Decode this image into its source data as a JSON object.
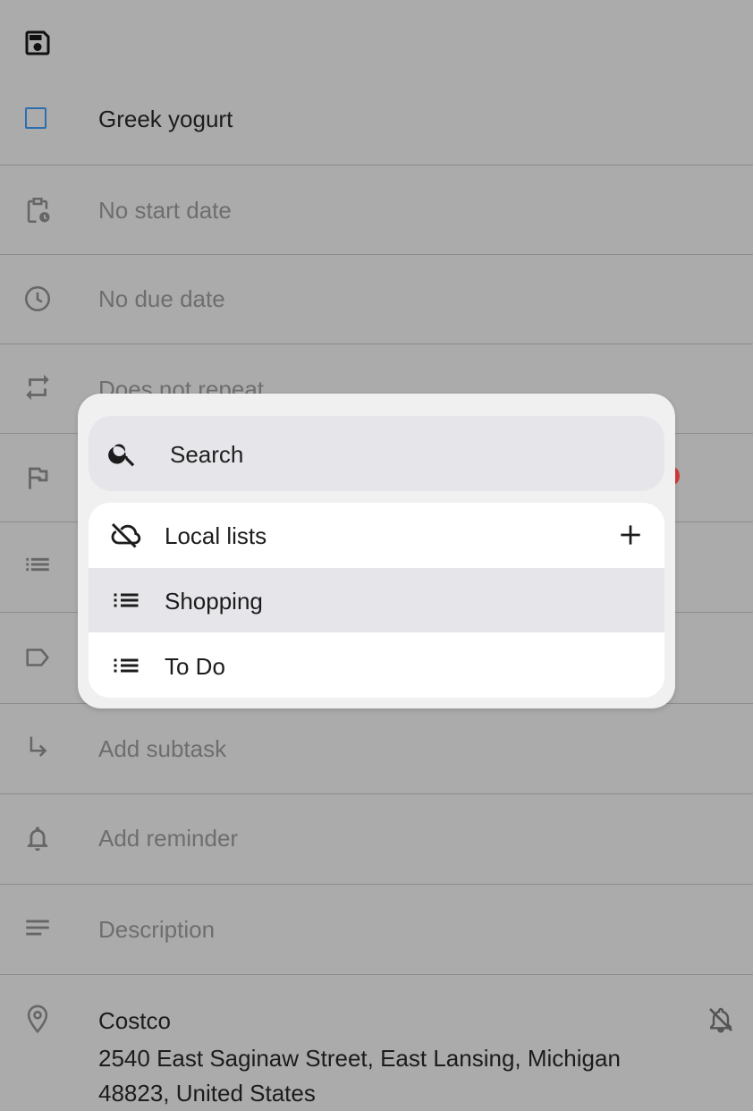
{
  "task": {
    "title": "Greek yogurt",
    "start_date": "No start date",
    "due_date": "No due date",
    "repeat": "Does not repeat",
    "subtask": "Add subtask",
    "reminder": "Add reminder",
    "description": "Description"
  },
  "location": {
    "name": "Costco",
    "address": "2540 East Saginaw Street, East Lansing, Michigan 48823, United States"
  },
  "list_picker": {
    "search_label": "Search",
    "group_label": "Local lists",
    "lists": [
      {
        "label": "Shopping",
        "selected": true
      },
      {
        "label": "To Do",
        "selected": false
      }
    ]
  },
  "colors": {
    "checkbox": "#2c6fb0",
    "scrim": "#ababab",
    "dialog": "#f0f0f0",
    "selected_item": "#e6e5ea",
    "priority_dot": "#d23a3a"
  },
  "icons": {
    "save": "save-icon",
    "start_date": "calendar-clock-icon",
    "due_date": "clock-icon",
    "repeat": "repeat-icon",
    "priority": "flag-icon",
    "list": "list-icon",
    "tags": "label-icon",
    "subtask": "subdirectory-arrow-icon",
    "reminder": "bell-icon",
    "description": "notes-icon",
    "location": "location-pin-icon",
    "geofence": "bell-off-icon",
    "search": "search-icon",
    "local_lists": "cloud-off-icon",
    "add": "plus-icon"
  }
}
